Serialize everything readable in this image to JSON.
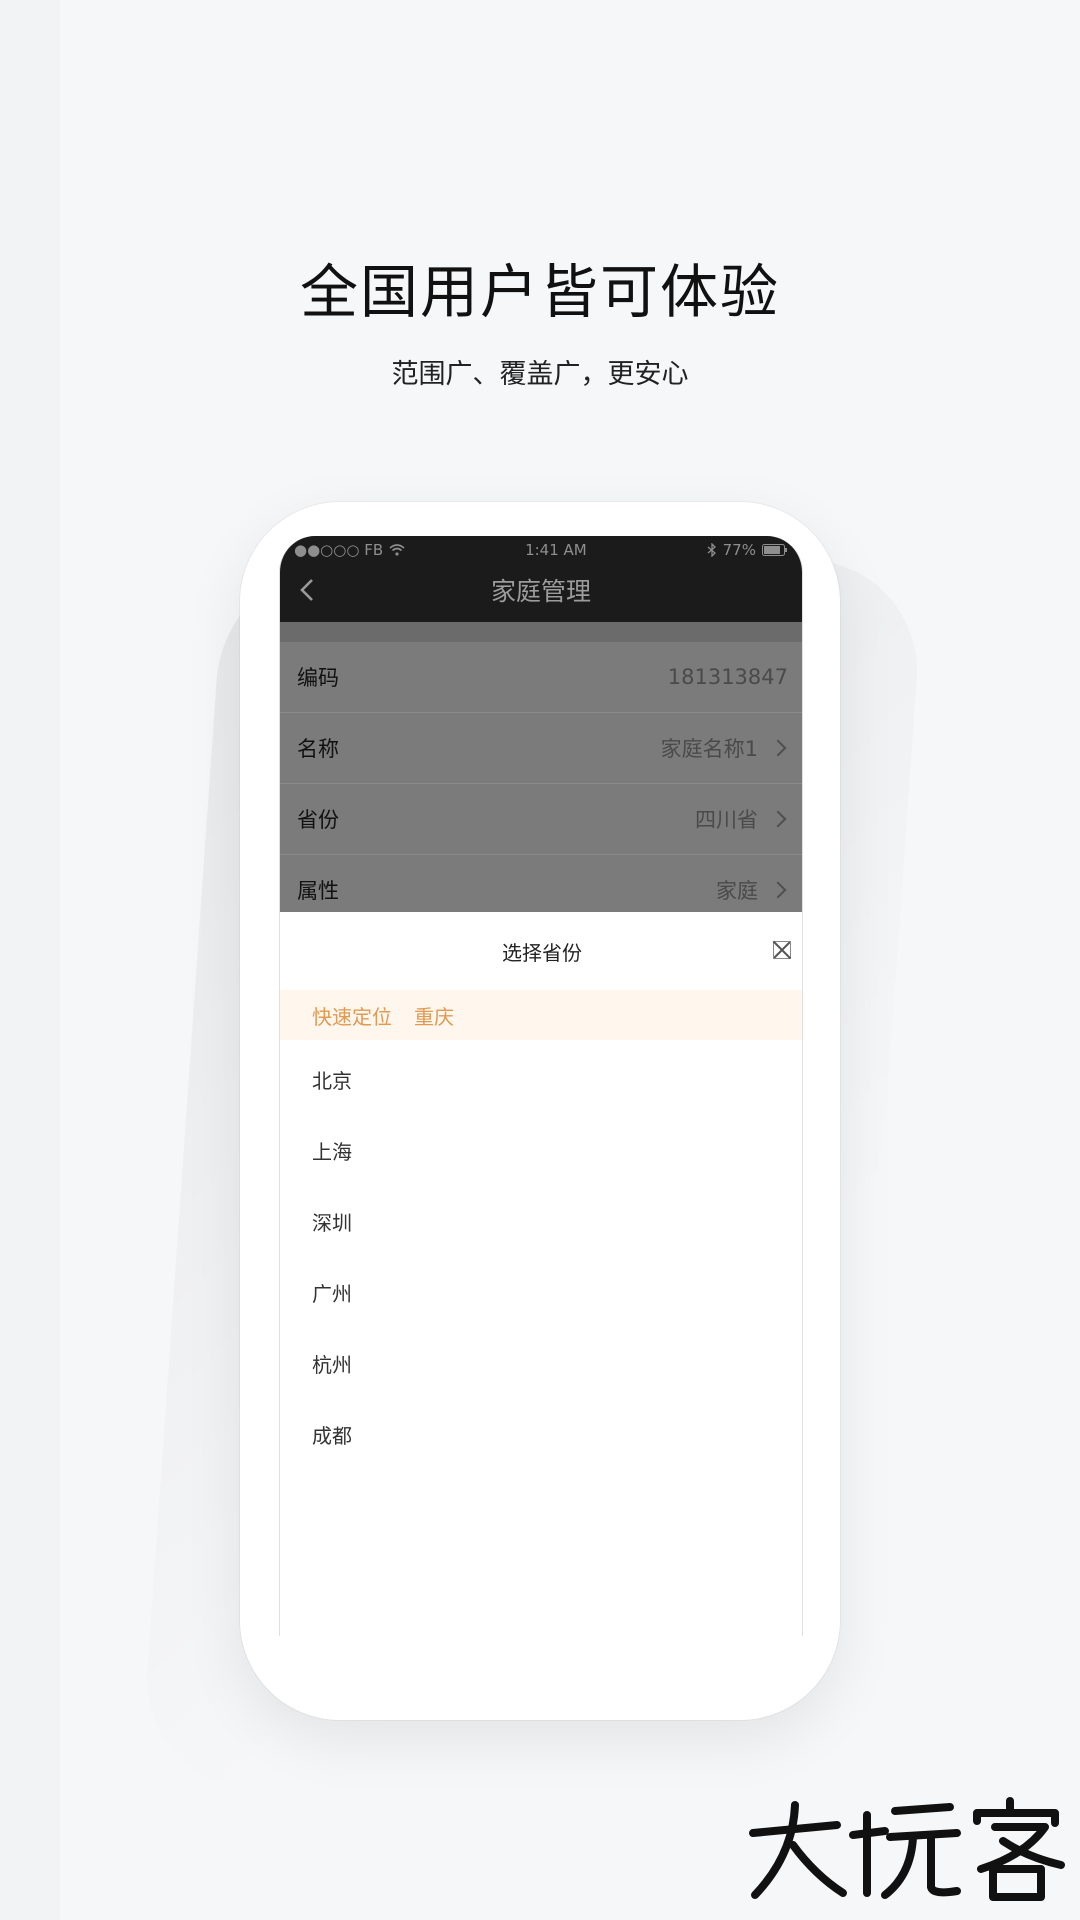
{
  "page": {
    "headline": "全国用户皆可体验",
    "subheadline": "范围广、覆盖广，更安心"
  },
  "status_bar": {
    "carrier": "●●○○○ FB",
    "time": "1:41 AM",
    "battery": "77%",
    "icons": [
      "signal-dots-icon",
      "wifi-icon",
      "bluetooth-icon",
      "battery-icon"
    ]
  },
  "navbar": {
    "back_icon": "chevron-left-icon",
    "title": "家庭管理"
  },
  "rows": [
    {
      "label": "编码",
      "value": "181313847",
      "has_chevron": false
    },
    {
      "label": "名称",
      "value": "家庭名称1",
      "has_chevron": true
    },
    {
      "label": "省份",
      "value": "四川省",
      "has_chevron": true
    },
    {
      "label": "属性",
      "value": "家庭",
      "has_chevron": true
    }
  ],
  "sheet": {
    "title": "选择省份",
    "close_icon": "close-icon",
    "quick_locate_label": "快速定位",
    "quick_locate_value": "重庆",
    "items": [
      "北京",
      "上海",
      "深圳",
      "广州",
      "杭州",
      "成都"
    ]
  },
  "watermark": {
    "text": "大玩客"
  },
  "colors": {
    "background": "#f6f7f9",
    "navbar": "#1b1b1b",
    "overlay": "#7b7b7b",
    "quick_locate_bg": "#fff7ee",
    "quick_locate_text": "#e09a52"
  }
}
